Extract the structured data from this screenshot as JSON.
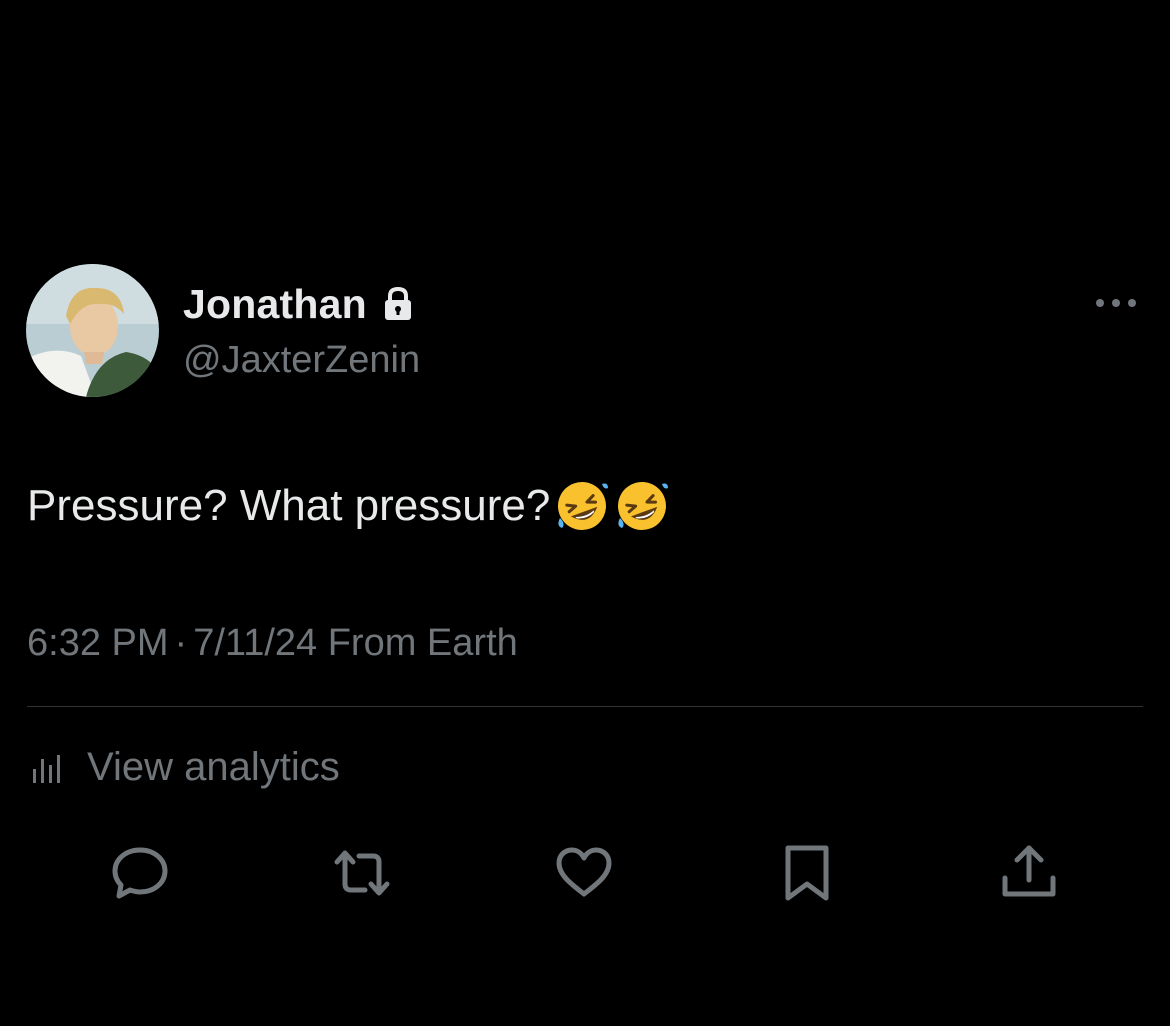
{
  "tweet": {
    "author": {
      "display_name": "Jonathan",
      "handle": "@JaxterZenin",
      "protected": true
    },
    "text": "Pressure? What pressure?",
    "emojis": [
      "rolling-on-floor-laughing",
      "rolling-on-floor-laughing"
    ],
    "time": "6:32 PM",
    "separator": "·",
    "date": "7/11/24",
    "location_label": "From Earth"
  },
  "analytics": {
    "label": "View analytics"
  },
  "actions": [
    "reply",
    "retweet",
    "like",
    "bookmark",
    "share"
  ],
  "colors": {
    "background": "#000000",
    "primary_text": "#e7e9ea",
    "secondary_text": "#71767b",
    "divider": "#2f3336",
    "emoji_yellow": "#f9c12e"
  }
}
